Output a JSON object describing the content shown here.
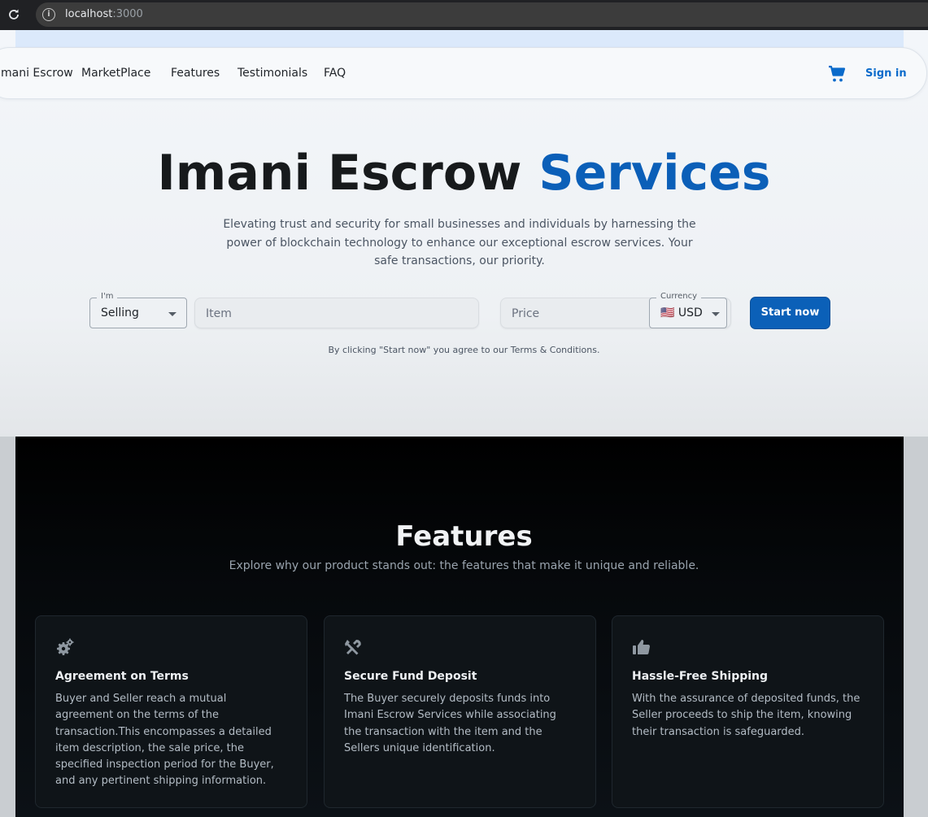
{
  "browser": {
    "host": "localhost",
    "port": ":3000"
  },
  "nav": {
    "brand": "mani Escrow",
    "items": [
      "MarketPlace",
      "Features",
      "Testimonials",
      "FAQ"
    ],
    "sign_in": "Sign in",
    "theme_icon": "dark-mode-icon",
    "cart_icon": "cart-icon"
  },
  "hero": {
    "title_main": "Imani Escrow",
    "title_accent": "Services",
    "subtitle": "Elevating trust and security for small businesses and individuals by harnessing the power of blockchain technology to enhance our exceptional escrow services. Your safe transactions, our priority."
  },
  "form": {
    "role_label": "I'm",
    "role_value": "Selling",
    "item_placeholder": "Item",
    "price_placeholder": "Price",
    "currency_label": "Currency",
    "currency_value": "🇺🇸 USD",
    "start_button": "Start now",
    "terms": "By clicking \"Start now\" you agree to our Terms & Conditions."
  },
  "features": {
    "title": "Features",
    "subtitle": "Explore why our product stands out: the features that make it unique and reliable.",
    "cards": [
      {
        "icon": "gears-icon",
        "title": "Agreement on Terms",
        "text": "Buyer and Seller reach a mutual agreement on the terms of the transaction.This encompasses a detailed item description, the sale price, the specified inspection period for the Buyer, and any pertinent shipping information."
      },
      {
        "icon": "tools-icon",
        "title": "Secure Fund Deposit",
        "text": "The Buyer securely deposits funds into Imani Escrow Services while associating the transaction with the item and the Sellers unique identification."
      },
      {
        "icon": "thumbs-up-icon",
        "title": "Hassle-Free Shipping",
        "text": "With the assurance of deposited funds, the Seller proceeds to ship the item, knowing their transaction is safeguarded."
      }
    ]
  },
  "colors": {
    "accent": "#0b5fb8",
    "button": "#0b60b8",
    "features_bg": "#06090c"
  }
}
